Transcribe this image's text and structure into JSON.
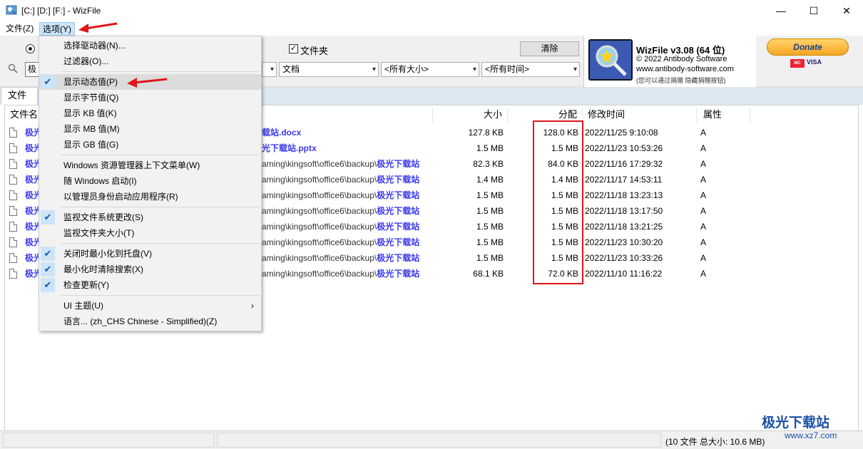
{
  "window": {
    "title": "[C:] [D:] [F:]  - WizFile"
  },
  "menubar": {
    "file": "文件(Z)",
    "options": "选项(Y)"
  },
  "toolbar": {
    "folder_checkbox_label": "文件夹",
    "clear_button": "清除",
    "search_value": "极",
    "filter_doc": "文档",
    "filter_size": "<所有大小>",
    "filter_time": "<所有时间>"
  },
  "logo": {
    "title": "WizFile v3.08 (64 位)",
    "copyright": "© 2022 Antibody Software",
    "url": "www.antibody-software.com",
    "note": "(您可以通过捐赠 隐藏捐赠按钮)"
  },
  "donate": {
    "label": "Donate",
    "visa": "VISA"
  },
  "tabs": {
    "files": "文件"
  },
  "columns": {
    "name": "文件名",
    "size": "大小",
    "alloc": "分配",
    "modified": "修改时间",
    "attr": "属性"
  },
  "rows": [
    {
      "name": "极光",
      "path_prefix": "",
      "path_bold": "载站.docx",
      "size": "127.8 KB",
      "alloc": "128.0 KB",
      "modified": "2022/11/25 9:10:08",
      "attr": "A"
    },
    {
      "name": "极光",
      "path_prefix": "",
      "path_bold": "光下载站.pptx",
      "size": "1.5 MB",
      "alloc": "1.5 MB",
      "modified": "2022/11/23 10:53:26",
      "attr": "A"
    },
    {
      "name": "极光",
      "path_prefix": "aming\\kingsoft\\office6\\backup\\",
      "path_bold": "极光下载站",
      "size": "82.3 KB",
      "alloc": "84.0 KB",
      "modified": "2022/11/16 17:29:32",
      "attr": "A"
    },
    {
      "name": "极光",
      "path_prefix": "aming\\kingsoft\\office6\\backup\\",
      "path_bold": "极光下载站",
      "size": "1.4 MB",
      "alloc": "1.4 MB",
      "modified": "2022/11/17 14:53:11",
      "attr": "A"
    },
    {
      "name": "极光",
      "path_prefix": "aming\\kingsoft\\office6\\backup\\",
      "path_bold": "极光下载站",
      "size": "1.5 MB",
      "alloc": "1.5 MB",
      "modified": "2022/11/18 13:23:13",
      "attr": "A"
    },
    {
      "name": "极光",
      "path_prefix": "aming\\kingsoft\\office6\\backup\\",
      "path_bold": "极光下载站",
      "size": "1.5 MB",
      "alloc": "1.5 MB",
      "modified": "2022/11/18 13:17:50",
      "attr": "A"
    },
    {
      "name": "极光",
      "path_prefix": "aming\\kingsoft\\office6\\backup\\",
      "path_bold": "极光下载站",
      "size": "1.5 MB",
      "alloc": "1.5 MB",
      "modified": "2022/11/18 13:21:25",
      "attr": "A"
    },
    {
      "name": "极光",
      "path_prefix": "aming\\kingsoft\\office6\\backup\\",
      "path_bold": "极光下载站",
      "size": "1.5 MB",
      "alloc": "1.5 MB",
      "modified": "2022/11/23 10:30:20",
      "attr": "A"
    },
    {
      "name": "极光",
      "path_prefix": "aming\\kingsoft\\office6\\backup\\",
      "path_bold": "极光下载站",
      "size": "1.5 MB",
      "alloc": "1.5 MB",
      "modified": "2022/11/23 10:33:26",
      "attr": "A"
    },
    {
      "name": "极光",
      "path_prefix": "aming\\kingsoft\\office6\\backup\\",
      "path_bold": "极光下载站",
      "size": "68.1 KB",
      "alloc": "72.0 KB",
      "modified": "2022/11/10 11:16:22",
      "attr": "A"
    }
  ],
  "status": {
    "summary": "(10 文件  总大小: 10.6 MB)"
  },
  "options_menu": {
    "select_drives": "选择驱动器(N)...",
    "filters": "过滤器(O)...",
    "show_dynamic": "显示动态值(P)",
    "show_bytes": "显示字节值(Q)",
    "show_kb": "显示 KB 值(K)",
    "show_mb": "显示 MB 值(M)",
    "show_gb": "显示 GB 值(G)",
    "explorer_context": "Windows 资源管理器上下文菜单(W)",
    "start_with_windows": "随 Windows 启动(I)",
    "run_as_admin": "以管理员身份启动应用程序(R)",
    "monitor_fs": "监视文件系统更改(S)",
    "monitor_folder_size": "监视文件夹大小(T)",
    "minimize_to_tray": "关闭时最小化到托盘(V)",
    "clear_on_minimize": "最小化时清除搜索(X)",
    "check_updates": "检查更新(Y)",
    "ui_theme": "UI 主题(U)",
    "language": "语言... (zh_CHS Chinese - Simplified)(Z)"
  },
  "watermark": {
    "brand": "极光下载站",
    "url": "www.xz7.com"
  },
  "colors": {
    "accent": "#3a3af0",
    "highlight_box": "#e0161b",
    "menu_selected": "#cce4f7"
  }
}
